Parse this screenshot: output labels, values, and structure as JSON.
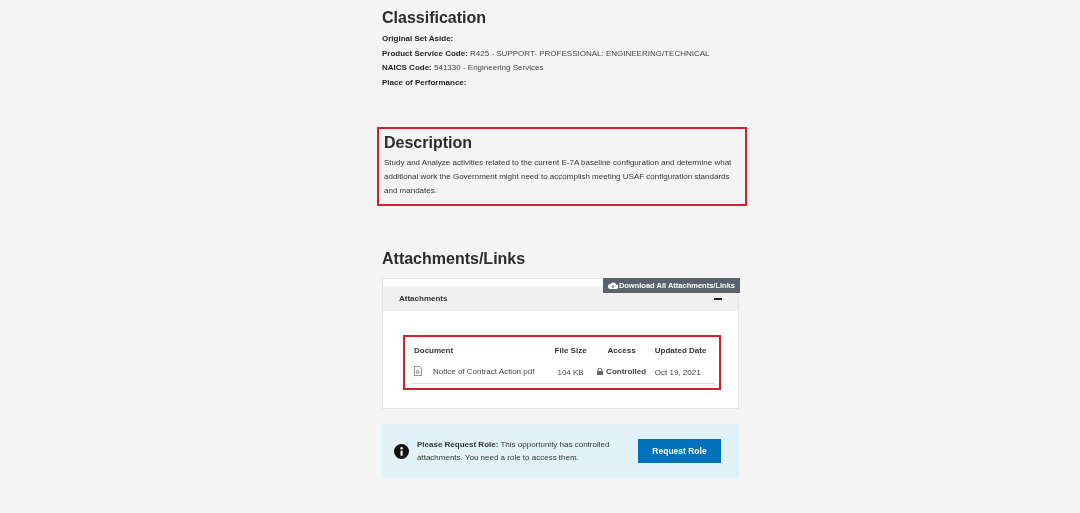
{
  "classification": {
    "title": "Classification",
    "fields": [
      {
        "label": "Original Set Aside:"
      },
      {
        "label": "Product Service Code:",
        "value": "R425 - SUPPORT- PROFESSIONAL: ENGINEERING/TECHNICAL"
      },
      {
        "label": "NAICS Code:",
        "value": "541330 - Engineering Services"
      },
      {
        "label": "Place of Performance:"
      }
    ]
  },
  "description": {
    "title": "Description",
    "text": "Study and Analyze activities related to the current E-7A baseline configuration and determine what additional work the Government might need to accomplish meeting USAF configuration standards and mandates.",
    "highlighted": true
  },
  "attachments": {
    "title": "Attachments/Links",
    "download_button": "Download All Attachments/Links",
    "panel_title": "Attachments",
    "expanded": true,
    "table": {
      "highlighted": true,
      "columns": [
        "Document",
        "File Size",
        "Access",
        "Updated Date"
      ],
      "rows": [
        {
          "document": "Notice of Contract Action.pdf",
          "file_size": "104 KB",
          "access": "Controlled",
          "updated_date": "Oct 19, 2021"
        }
      ]
    }
  },
  "notice": {
    "label": "Please Request Role:",
    "text": "This opportunity has controlled attachments. You need a role to access them.",
    "button": "Request Role"
  }
}
